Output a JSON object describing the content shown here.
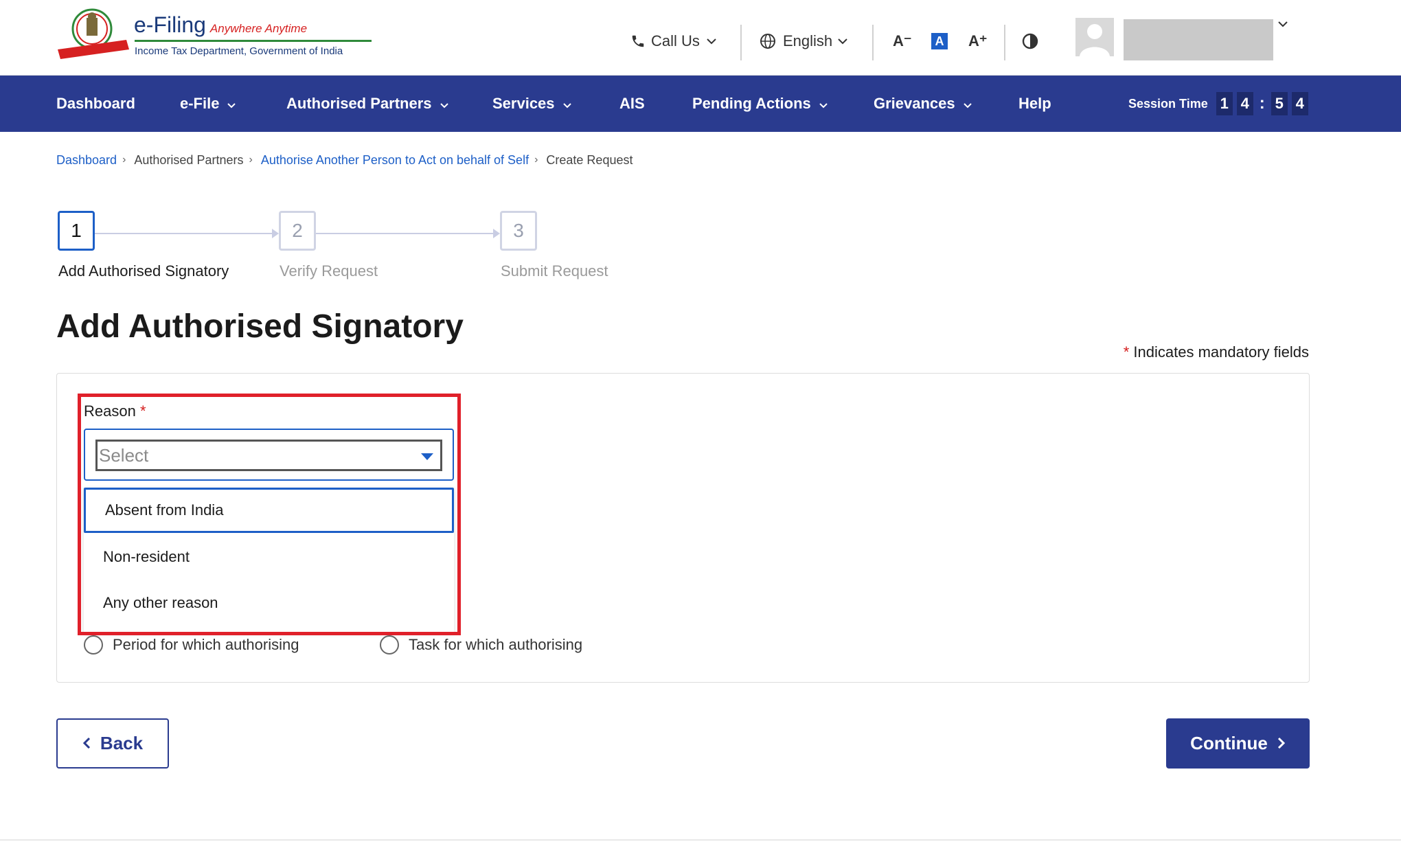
{
  "header": {
    "brand_main": "e-Filing",
    "brand_sub": "Anywhere Anytime",
    "brand_dept": "Income Tax Department, Government of India",
    "call_us": "Call Us",
    "language": "English",
    "font_decrease": "A⁻",
    "font_default": "A",
    "font_increase": "A⁺"
  },
  "nav": {
    "items": [
      {
        "label": "Dashboard",
        "has_caret": false
      },
      {
        "label": "e-File",
        "has_caret": true
      },
      {
        "label": "Authorised Partners",
        "has_caret": true
      },
      {
        "label": "Services",
        "has_caret": true
      },
      {
        "label": "AIS",
        "has_caret": false
      },
      {
        "label": "Pending Actions",
        "has_caret": true
      },
      {
        "label": "Grievances",
        "has_caret": true
      },
      {
        "label": "Help",
        "has_caret": false
      }
    ],
    "session_label": "Session Time",
    "session_digits": [
      "1",
      "4",
      ":",
      "5",
      "4"
    ]
  },
  "breadcrumb": [
    {
      "label": "Dashboard",
      "link": true
    },
    {
      "label": "Authorised Partners",
      "link": false
    },
    {
      "label": "Authorise Another Person to Act on behalf of Self",
      "link": true
    },
    {
      "label": "Create Request",
      "link": false
    }
  ],
  "steps": [
    {
      "number": "1",
      "label": "Add Authorised Signatory",
      "active": true
    },
    {
      "number": "2",
      "label": "Verify Request",
      "active": false
    },
    {
      "number": "3",
      "label": "Submit Request",
      "active": false
    }
  ],
  "page_title": "Add Authorised Signatory",
  "mandatory_note": {
    "asterisk": "*",
    "text": "Indicates mandatory fields"
  },
  "form": {
    "reason_label": "Reason",
    "required_mark": "*",
    "select_value": "Select",
    "options": [
      "Absent from India",
      "Non-resident",
      "Any other reason"
    ],
    "radio_period": "Period for which authorising",
    "radio_task": "Task for which authorising"
  },
  "buttons": {
    "back": "Back",
    "continue": "Continue"
  },
  "colors": {
    "primary": "#2a3b8f",
    "link": "#1d5fc7",
    "highlight": "#e0202a"
  }
}
